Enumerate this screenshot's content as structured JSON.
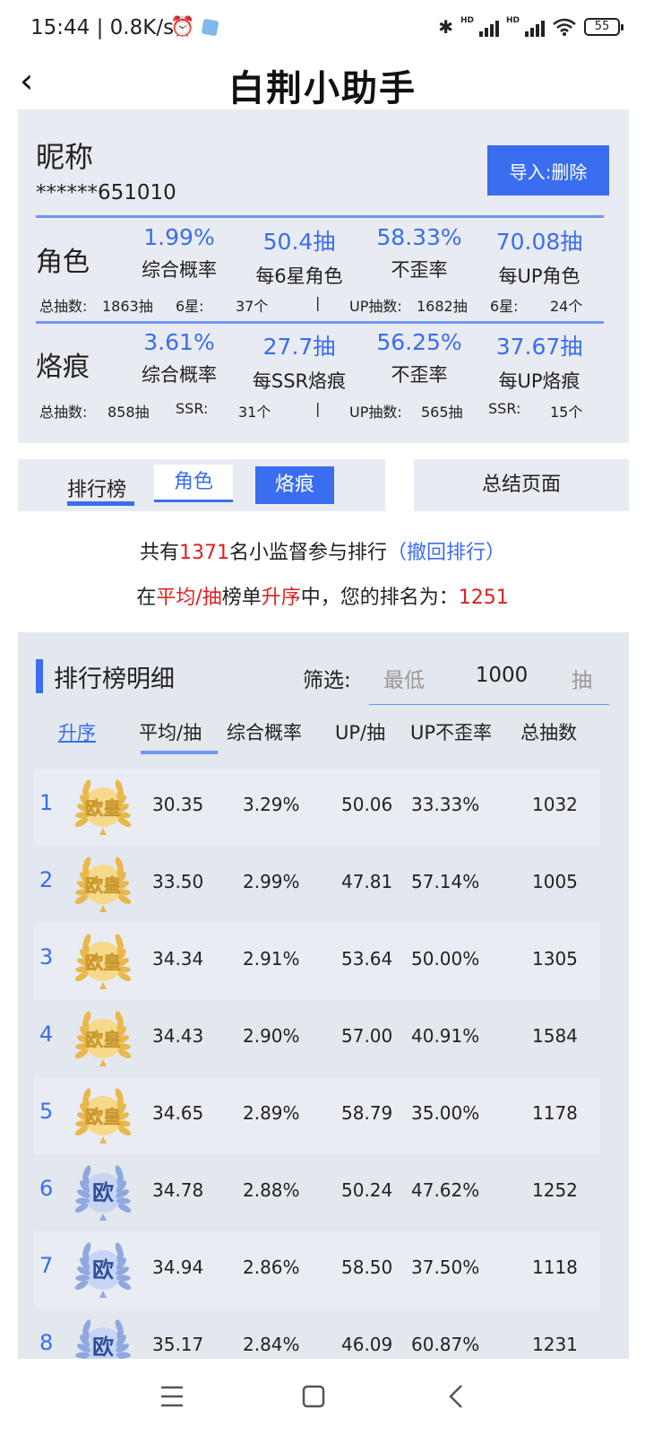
{
  "status_bar": {
    "time": "15:44 | 0.8K/s",
    "alarm_icon": "alarm-clock-icon",
    "battery": "55",
    "hd": "HD"
  },
  "header": {
    "back_icon": "back-chevron-icon",
    "title": "白荆小助手"
  },
  "profile": {
    "nickname": "昵称",
    "uid": "******651010",
    "import_button": "导入:删除"
  },
  "stats": [
    {
      "label": "角色",
      "metrics": [
        {
          "value": "1.99%",
          "label": "综合概率"
        },
        {
          "value": "50.4抽",
          "label": "每6星角色"
        },
        {
          "value": "58.33%",
          "label": "不歪率"
        },
        {
          "value": "70.08抽",
          "label": "每UP角色"
        }
      ],
      "counts": {
        "total_label": "总抽数:",
        "total": "1863抽",
        "star_label": "6星:",
        "star": "37个",
        "divider": "|",
        "up_label": "UP抽数:",
        "up": "1682抽",
        "up_star_label": "6星:",
        "up_star": "24个"
      }
    },
    {
      "label": "烙痕",
      "metrics": [
        {
          "value": "3.61%",
          "label": "综合概率"
        },
        {
          "value": "27.7抽",
          "label": "每SSR烙痕"
        },
        {
          "value": "56.25%",
          "label": "不歪率"
        },
        {
          "value": "37.67抽",
          "label": "每UP烙痕"
        }
      ],
      "counts": {
        "total_label": "总抽数:",
        "total": "858抽",
        "star_label": "SSR:",
        "star": "31个",
        "divider": "|",
        "up_label": "UP抽数:",
        "up": "565抽",
        "up_star_label": "SSR:",
        "up_star": "15个"
      }
    }
  ],
  "tabs": {
    "rank": "排行榜",
    "role": "角色",
    "mark": "烙痕",
    "summary": "总结页面"
  },
  "info": {
    "line1_pre": "共有",
    "line1_count": "1371",
    "line1_post": "名小监督参与排行",
    "line1_link": "（撤回排行）",
    "line2_pre": "在",
    "line2_board": "平均/抽",
    "line2_mid": "榜单",
    "line2_order": "升序",
    "line2_post": "中，您的排名为：",
    "line2_rank": "1251"
  },
  "leaderboard": {
    "title": "排行榜明细",
    "filter_label": "筛选:",
    "filter_placeholder": "最低",
    "filter_value": "1000",
    "filter_unit": "抽",
    "sort": "升序",
    "columns": [
      "平均/抽",
      "综合概率",
      "UP/抽",
      "UP不歪率",
      "总抽数"
    ],
    "rows": [
      {
        "rank": "1",
        "badge": "欧皇",
        "tier": "gold",
        "avg": "30.35",
        "rate": "3.29%",
        "up": "50.06",
        "up_rate": "33.33%",
        "total": "1032"
      },
      {
        "rank": "2",
        "badge": "欧皇",
        "tier": "gold",
        "avg": "33.50",
        "rate": "2.99%",
        "up": "47.81",
        "up_rate": "57.14%",
        "total": "1005"
      },
      {
        "rank": "3",
        "badge": "欧皇",
        "tier": "gold",
        "avg": "34.34",
        "rate": "2.91%",
        "up": "53.64",
        "up_rate": "50.00%",
        "total": "1305"
      },
      {
        "rank": "4",
        "badge": "欧皇",
        "tier": "gold",
        "avg": "34.43",
        "rate": "2.90%",
        "up": "57.00",
        "up_rate": "40.91%",
        "total": "1584"
      },
      {
        "rank": "5",
        "badge": "欧皇",
        "tier": "gold",
        "avg": "34.65",
        "rate": "2.89%",
        "up": "58.79",
        "up_rate": "35.00%",
        "total": "1178"
      },
      {
        "rank": "6",
        "badge": "欧",
        "tier": "blue",
        "avg": "34.78",
        "rate": "2.88%",
        "up": "50.24",
        "up_rate": "47.62%",
        "total": "1252"
      },
      {
        "rank": "7",
        "badge": "欧",
        "tier": "blue",
        "avg": "34.94",
        "rate": "2.86%",
        "up": "58.50",
        "up_rate": "37.50%",
        "total": "1118"
      },
      {
        "rank": "8",
        "badge": "欧",
        "tier": "blue",
        "avg": "35.17",
        "rate": "2.84%",
        "up": "46.09",
        "up_rate": "60.87%",
        "total": "1231"
      }
    ]
  },
  "nav": {
    "menu_icon": "menu-icon",
    "home_icon": "home-square-icon",
    "back_icon": "nav-back-icon"
  },
  "colors": {
    "accent": "#3a6df0",
    "highlight": "#e02020",
    "panel": "#e8ebf1",
    "gold": "#e8b84a",
    "badge_blue": "#2f4f9a"
  }
}
